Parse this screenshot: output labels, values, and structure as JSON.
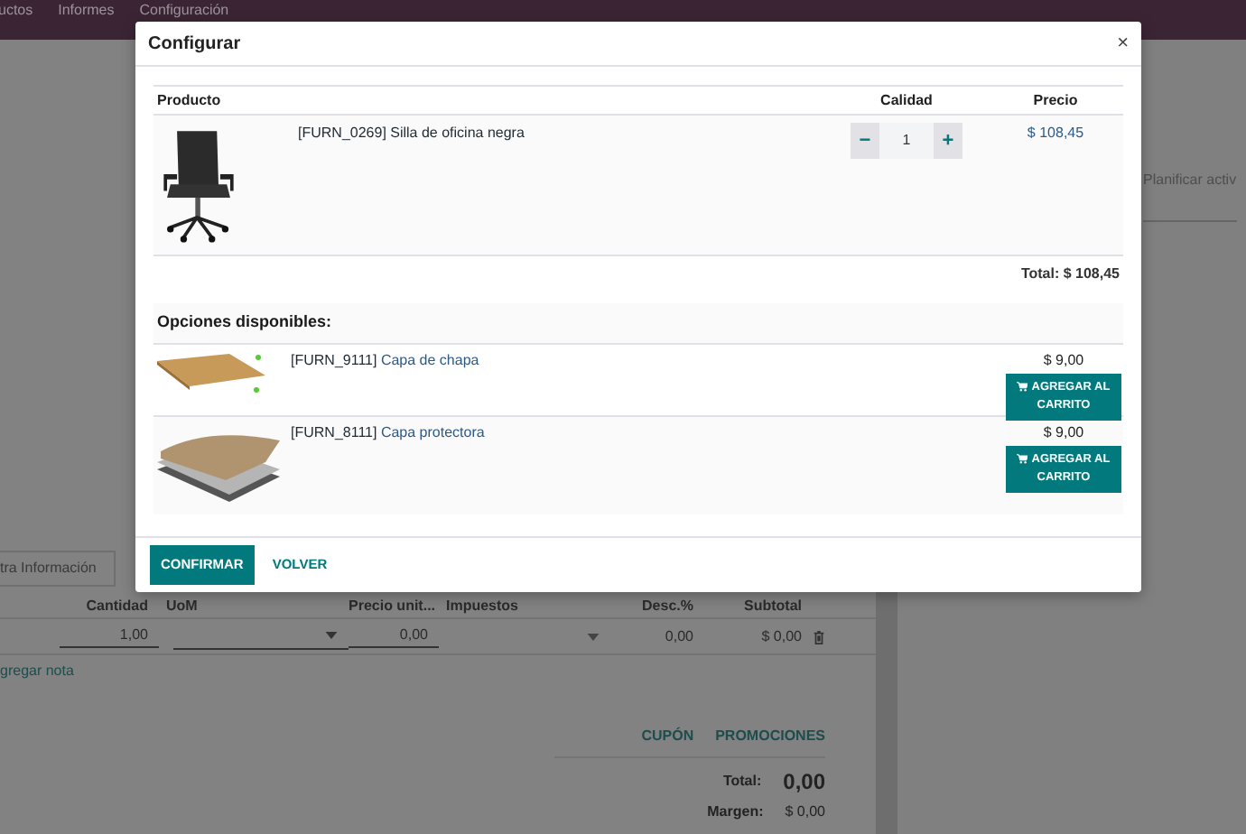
{
  "topbar": {
    "menu": [
      "uctos",
      "Informes",
      "Configuración"
    ]
  },
  "background": {
    "activity_link": "Planificar activ",
    "tab": "tra Información",
    "columns": [
      "Cantidad",
      "UoM",
      "Precio unit...",
      "Impuestos",
      "Desc.%",
      "Subtotal"
    ],
    "line": {
      "quantity": "1,00",
      "price": "0,00",
      "discount": "0,00",
      "subtotal": "$ 0,00"
    },
    "add_note": "gregar nota",
    "actions": [
      "CUPÓN",
      "PROMOCIONES"
    ],
    "total_label": "Total:",
    "total": "0,00",
    "margin_label": "Margen:",
    "margin": "$ 0,00"
  },
  "dialog": {
    "title": "Configurar",
    "close": "×",
    "columns": [
      "Producto",
      "Calidad",
      "Precio"
    ],
    "product": {
      "name": "[FURN_0269] Silla de oficina negra",
      "quantity": "1",
      "decrease": "−",
      "increase": "+",
      "price": "$ 108,45"
    },
    "total": "Total: $ 108,45",
    "options_title": "Opciones disponibles:",
    "options": [
      {
        "code": "[FURN_9111]",
        "name": "Capa de chapa",
        "price": "$ 9,00",
        "button": "AGREGAR AL CARRITO",
        "kind": "veneer"
      },
      {
        "code": "[FURN_8111]",
        "name": "Capa protectora",
        "price": "$ 9,00",
        "button": "AGREGAR AL CARRITO",
        "kind": "layers"
      }
    ],
    "buttons": [
      {
        "label": "CONFIRMAR",
        "kind": "primary"
      },
      {
        "label": "VOLVER",
        "kind": "link"
      }
    ]
  }
}
